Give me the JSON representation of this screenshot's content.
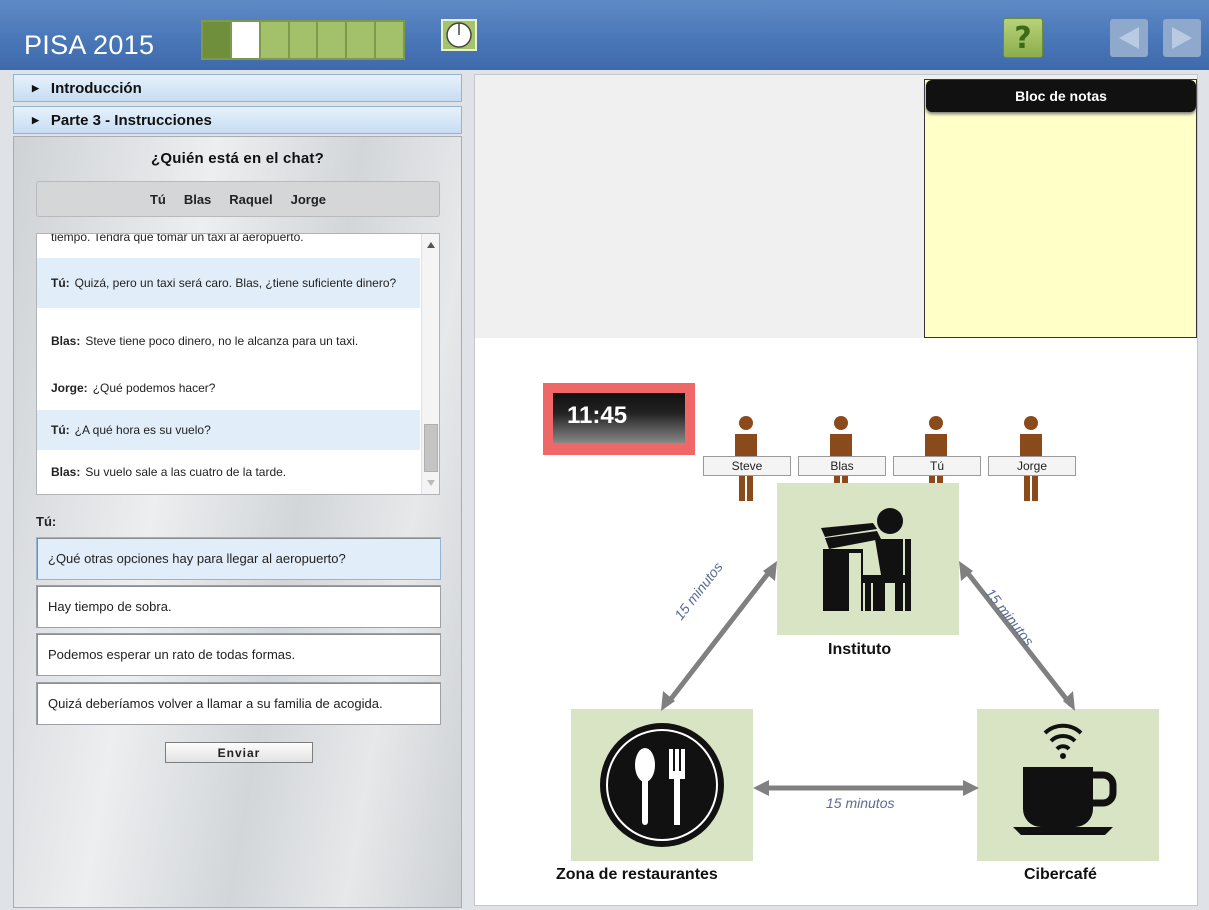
{
  "header": {
    "app_title": "PISA 2015",
    "progress": {
      "total_units": 7,
      "completed": 1,
      "current_index": 2
    },
    "timer_icon": "clock-icon",
    "help_label": "?",
    "nav": {
      "back_icon": "triangle-left-icon",
      "next_icon": "triangle-right-icon"
    }
  },
  "sidebar": {
    "sections": [
      {
        "label": "Introducción"
      },
      {
        "label": "Parte 3 - Instrucciones"
      }
    ]
  },
  "chat": {
    "heading": "¿Quién está en el chat?",
    "participants": [
      "Tú",
      "Blas",
      "Raquel",
      "Jorge"
    ],
    "partial_line": "tiempo. Tendrá que tomar un taxi al aeropuerto.",
    "messages": [
      {
        "speaker": "Tú:",
        "text": "Quizá, pero un taxi será caro. Blas, ¿tiene suficiente dinero?"
      },
      {
        "speaker": "Blas:",
        "text": "Steve tiene poco dinero, no le alcanza para un taxi."
      },
      {
        "speaker": "Jorge:",
        "text": "¿Qué podemos hacer?"
      },
      {
        "speaker": "Tú:",
        "text": "¿A qué hora es su vuelo?"
      },
      {
        "speaker": "Blas:",
        "text": "Su vuelo sale a las cuatro de la tarde."
      }
    ],
    "reply_label": "Tú:",
    "options": [
      "¿Qué otras opciones hay para llegar al aeropuerto?",
      "Hay tiempo de sobra.",
      "Podemos esperar un rato de todas formas.",
      "Quizá deberíamos volver a llamar a su familia de acogida."
    ],
    "selected_option": 0,
    "send_label": "Enviar"
  },
  "notepad": {
    "title": "Bloc de notas"
  },
  "scenario": {
    "clock": "11:45",
    "people": [
      "Steve",
      "Blas",
      "Tú",
      "Jorge"
    ],
    "locations": {
      "school": {
        "label": "Instituto",
        "icon": "student-at-desk-icon"
      },
      "restaurants": {
        "label": "Zona de restaurantes",
        "icon": "fork-spoon-icon"
      },
      "cybercafe": {
        "label": "Cibercafé",
        "icon": "coffee-wifi-icon"
      }
    },
    "travel_times": {
      "school_restaurants": "15 minutos",
      "school_cybercafe": "15 minutos",
      "restaurants_cybercafe": "15 minutos"
    },
    "colors": {
      "location_bg": "#d9e4c5",
      "person": "#8b4a1c",
      "clock_frame": "#ef6766",
      "arrow": "#808080",
      "minutes_text": "#5b6b96"
    }
  }
}
